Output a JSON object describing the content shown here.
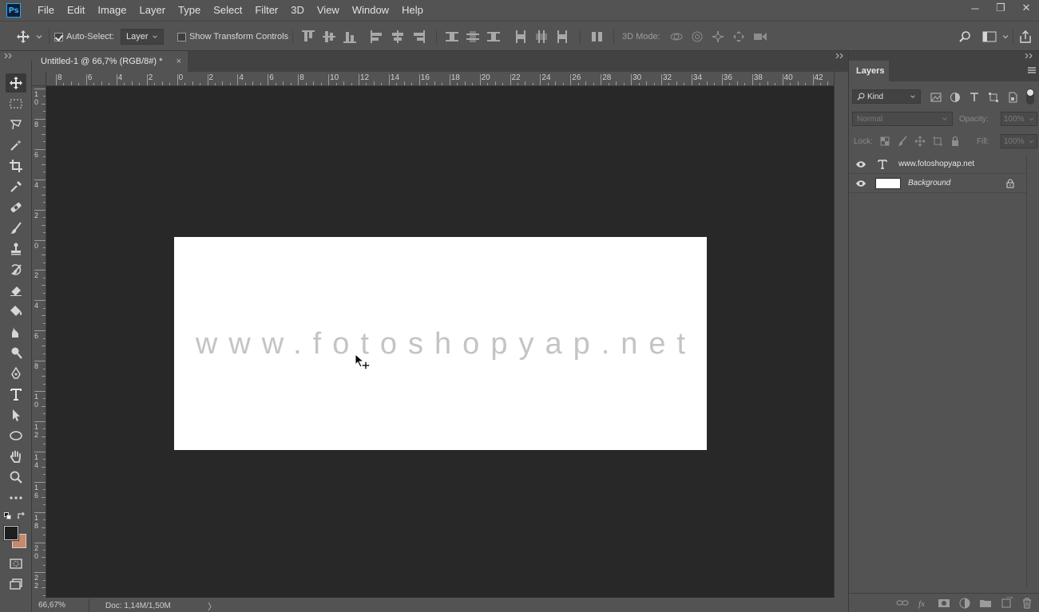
{
  "app": {
    "logo_text": "Ps"
  },
  "menu": [
    "File",
    "Edit",
    "Image",
    "Layer",
    "Type",
    "Select",
    "Filter",
    "3D",
    "View",
    "Window",
    "Help"
  ],
  "window_controls": {
    "minimize": "─",
    "restore": "❐",
    "close": "✕"
  },
  "options": {
    "auto_select_label": "Auto-Select:",
    "auto_select_checked": true,
    "auto_select_target": "Layer",
    "show_transform_label": "Show Transform Controls",
    "show_transform_checked": false,
    "mode_3d_label": "3D Mode:"
  },
  "document": {
    "tab_title": "Untitled-1 @ 66,7% (RGB/8#) *",
    "close_glyph": "×",
    "canvas_text": "www.fotoshopyap.net",
    "canvas_bg": "#ffffff",
    "text_color": "#c4c4c4"
  },
  "rulers": {
    "top_labels": [
      "8",
      "6",
      "4",
      "2",
      "0",
      "2",
      "4",
      "6",
      "8",
      "10",
      "12",
      "14",
      "16",
      "18",
      "20",
      "22",
      "24",
      "26",
      "28",
      "30",
      "32",
      "34",
      "36",
      "38",
      "40",
      "42"
    ],
    "left_labels": [
      "1\n0",
      "8",
      "6",
      "4",
      "2",
      "0",
      "2",
      "4",
      "6",
      "8",
      "1\n0",
      "1\n2",
      "1\n4",
      "1\n6",
      "1\n8",
      "2\n0",
      "2\n2"
    ]
  },
  "status": {
    "zoom": "66,67%",
    "doc": "Doc: 1,14M/1,50M",
    "arrow": "〉"
  },
  "layers_panel": {
    "tab_label": "Layers",
    "filter_kind": "Kind",
    "blend_mode": "Normal",
    "opacity_label": "Opacity:",
    "opacity_value": "100%",
    "lock_label": "Lock:",
    "fill_label": "Fill:",
    "fill_value": "100%",
    "layers": [
      {
        "name": "www.fotoshopyap.net",
        "type": "text",
        "visible": true,
        "locked": false
      },
      {
        "name": "Background",
        "type": "pixel",
        "visible": true,
        "locked": true
      }
    ],
    "bottom_icons": [
      "link-icon",
      "fx-icon",
      "mask-icon",
      "adjustment-icon",
      "group-folder-icon",
      "new-layer-icon",
      "trash-icon"
    ]
  },
  "colors": {
    "ui_bg": "#535353",
    "workspace_bg": "#282828",
    "foreground_swatch": "#1f1f1f",
    "background_swatch": "#c8896a",
    "ps_blue": "#31a8ff"
  }
}
